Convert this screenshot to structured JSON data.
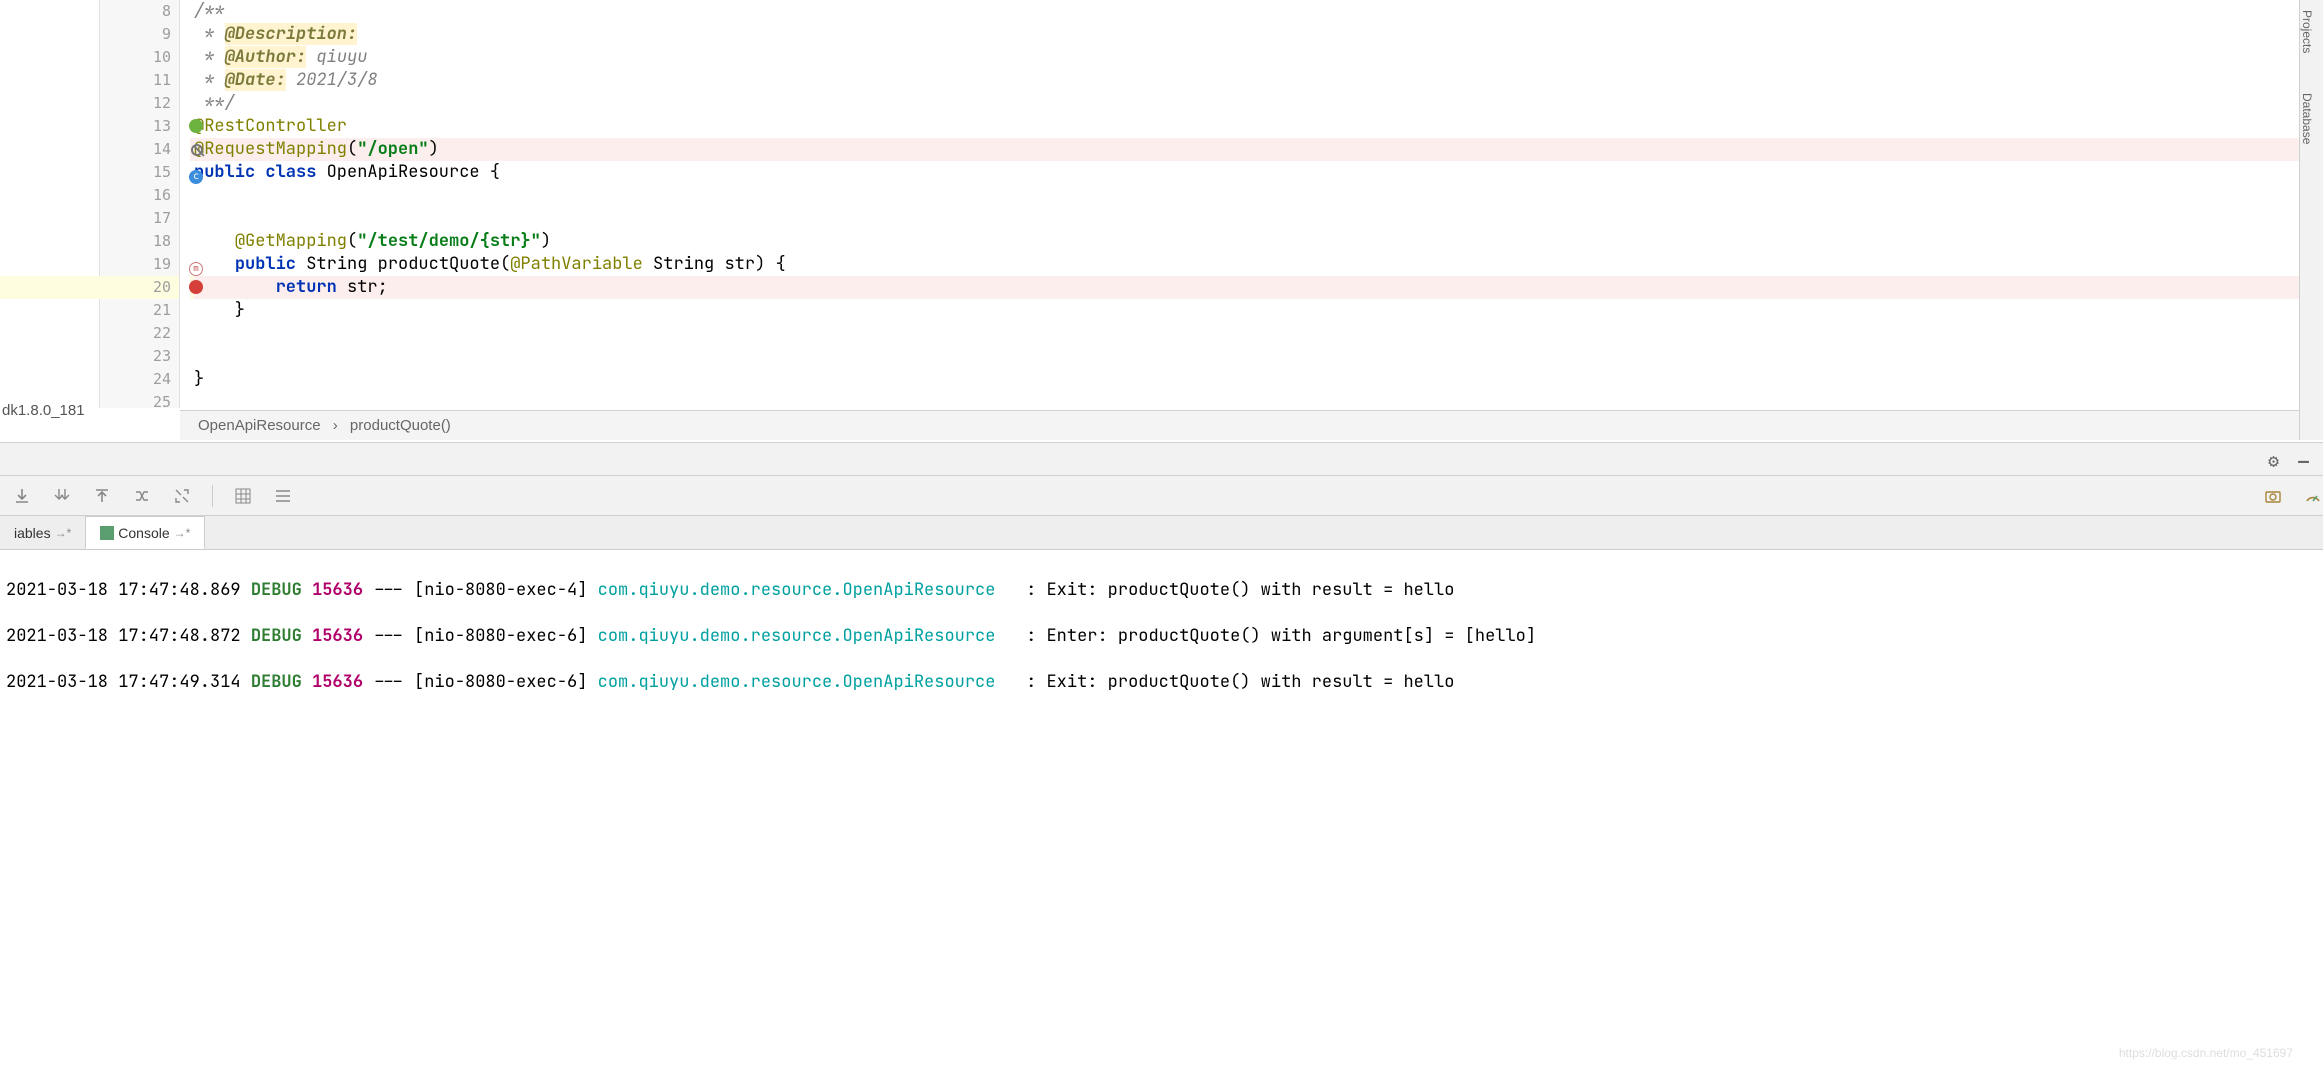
{
  "jdk": "dk1.8.0_181",
  "side_tools": {
    "projects": "Projects",
    "database": "Database"
  },
  "lines": {
    "8": {
      "n": "8",
      "ind": "/**",
      "doc": true
    },
    "9": {
      "n": "9",
      "pre": " * ",
      "tag": "@Description:",
      "rest": ""
    },
    "10": {
      "n": "10",
      "pre": " * ",
      "tag": "@Author:",
      "rest": " qiuyu"
    },
    "11": {
      "n": "11",
      "pre": " * ",
      "tag": "@Date:",
      "rest": " 2021/3/8"
    },
    "12": {
      "n": "12",
      "ind": " **/",
      "doc": true
    },
    "13": {
      "n": "13",
      "ann": "@RestController"
    },
    "14": {
      "n": "14",
      "ann": "@RequestMapping",
      "paren_open": "(",
      "str": "\"/open\"",
      "paren_close": ")"
    },
    "15": {
      "n": "15",
      "kw1": "public",
      "kw2": "class",
      "name": "OpenApiResource",
      "tail": " {"
    },
    "16": {
      "n": "16"
    },
    "17": {
      "n": "17"
    },
    "18": {
      "n": "18",
      "ind": "    ",
      "ann": "@GetMapping",
      "paren_open": "(",
      "str": "\"/test/demo/{str}\"",
      "paren_close": ")"
    },
    "19": {
      "n": "19",
      "ind": "    ",
      "kw1": "public",
      "ty": "String",
      "m": "productQuote",
      "po": "(",
      "ann2": "@PathVariable",
      "ty2": " String ",
      "arg": "str",
      "pc": ") {"
    },
    "20": {
      "n": "20",
      "ind": "        ",
      "kw1": "return",
      "rest": " str;"
    },
    "21": {
      "n": "21",
      "ind": "    }",
      "plain": true
    },
    "22": {
      "n": "22"
    },
    "23": {
      "n": "23"
    },
    "24": {
      "n": "24",
      "ind": "}",
      "plain": true
    },
    "25": {
      "n": "25"
    }
  },
  "breadcrumb": {
    "a": "OpenApiResource",
    "sep": "›",
    "b": "productQuote()"
  },
  "tabs": {
    "variables": "iables",
    "vpin": "→*",
    "console": "Console",
    "cpin": "→*"
  },
  "log": {
    "r1": {
      "ts": "2021-03-18 17:47:48.869",
      "lvl": "DEBUG",
      "pid": "15636",
      "sep": "---",
      "thr": "[nio-8080-exec-4]",
      "cls": "com.qiuyu.demo.resource.OpenApiResource",
      "colon": ":",
      "msg": "Exit: productQuote() with result = hello"
    },
    "r2": {
      "ts": "2021-03-18 17:47:48.872",
      "lvl": "DEBUG",
      "pid": "15636",
      "sep": "---",
      "thr": "[nio-8080-exec-6]",
      "cls": "com.qiuyu.demo.resource.OpenApiResource",
      "colon": ":",
      "msg": "Enter: productQuote() with argument[s] = [hello]"
    },
    "r3": {
      "ts": "2021-03-18 17:47:49.314",
      "lvl": "DEBUG",
      "pid": "15636",
      "sep": "---",
      "thr": "[nio-8080-exec-6]",
      "cls": "com.qiuyu.demo.resource.OpenApiResource",
      "colon": ":",
      "msg": "Exit: productQuote() with result = hello"
    }
  },
  "watermark": "https://blog.csdn.net/mo_451697"
}
